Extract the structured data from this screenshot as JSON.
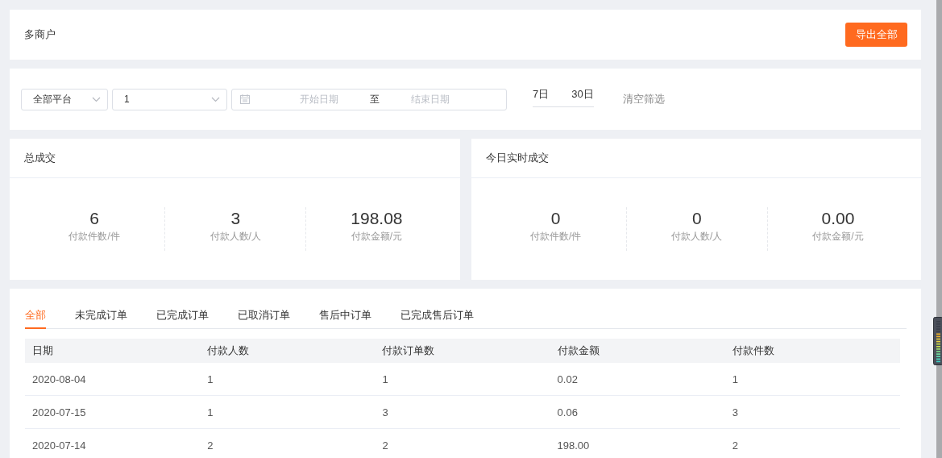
{
  "header": {
    "title": "多商户",
    "export_button": "导出全部"
  },
  "filters": {
    "platform": "全部平台",
    "store": "1",
    "start_placeholder": "开始日期",
    "separator": "至",
    "end_placeholder": "结束日期",
    "quick_ranges": [
      "7日",
      "30日"
    ],
    "clear": "清空筛选"
  },
  "stats": [
    {
      "title": "总成交",
      "metrics": [
        {
          "value": "6",
          "label": "付款件数/件"
        },
        {
          "value": "3",
          "label": "付款人数/人"
        },
        {
          "value": "198.08",
          "label": "付款金额/元"
        }
      ]
    },
    {
      "title": "今日实时成交",
      "metrics": [
        {
          "value": "0",
          "label": "付款件数/件"
        },
        {
          "value": "0",
          "label": "付款人数/人"
        },
        {
          "value": "0.00",
          "label": "付款金额/元"
        }
      ]
    }
  ],
  "orders": {
    "tabs": [
      {
        "label": "全部",
        "selected": true
      },
      {
        "label": "未完成订单",
        "selected": false
      },
      {
        "label": "已完成订单",
        "selected": false
      },
      {
        "label": "已取消订单",
        "selected": false
      },
      {
        "label": "售后中订单",
        "selected": false
      },
      {
        "label": "已完成售后订单",
        "selected": false
      }
    ],
    "table": {
      "columns": [
        "日期",
        "付款人数",
        "付款订单数",
        "付款金额",
        "付款件数"
      ],
      "rows": [
        [
          "2020-08-04",
          "1",
          "1",
          "0.02",
          "1"
        ],
        [
          "2020-07-15",
          "1",
          "3",
          "0.06",
          "3"
        ],
        [
          "2020-07-14",
          "2",
          "2",
          "198.00",
          "2"
        ]
      ]
    }
  }
}
